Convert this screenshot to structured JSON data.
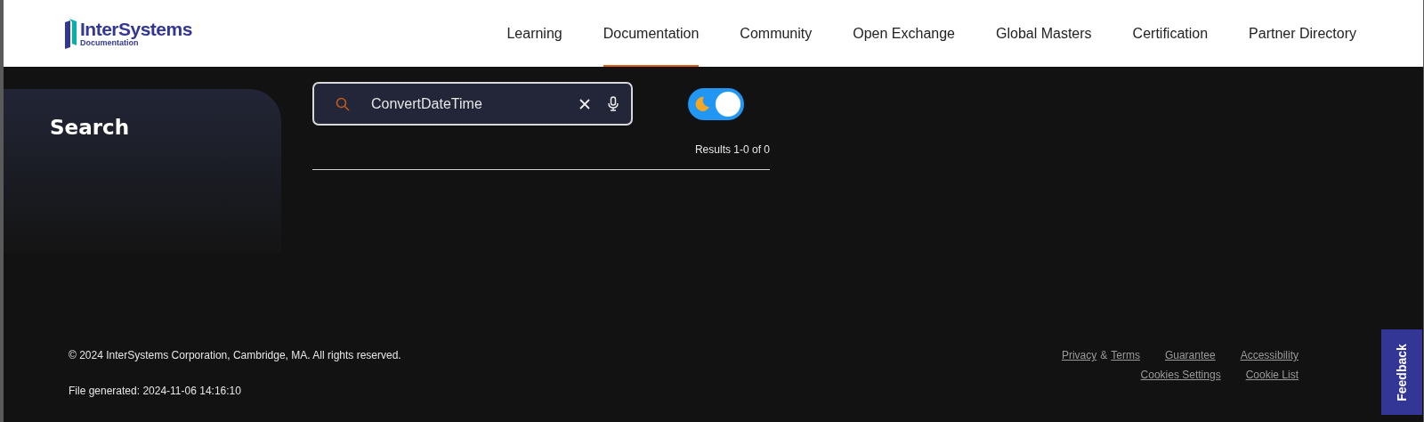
{
  "header": {
    "logo": {
      "name": "InterSystems",
      "subtitle": "Documentation"
    },
    "nav": [
      {
        "label": "Learning",
        "selected": false
      },
      {
        "label": "Documentation",
        "selected": true
      },
      {
        "label": "Community",
        "selected": false
      },
      {
        "label": "Open Exchange",
        "selected": false
      },
      {
        "label": "Global Masters",
        "selected": false
      },
      {
        "label": "Certification",
        "selected": false
      },
      {
        "label": "Partner Directory",
        "selected": false
      }
    ]
  },
  "sidebar": {
    "title": "Search"
  },
  "search": {
    "value": "ConvertDateTime"
  },
  "dark_mode_toggle": {
    "on": true
  },
  "results": "Results 1-0 of 0",
  "footer": {
    "copyright": "© 2024 InterSystems Corporation, Cambridge, MA. All rights reserved.",
    "generated": "File generated: 2024-11-06 14:16:10",
    "link_rows": [
      [
        {
          "kind": "link",
          "label": "Privacy"
        },
        {
          "kind": "text",
          "label": "&"
        },
        {
          "kind": "link",
          "label": "Terms"
        },
        {
          "kind": "gap"
        },
        {
          "kind": "link",
          "label": "Guarantee"
        },
        {
          "kind": "gap"
        },
        {
          "kind": "link",
          "label": "Accessibility"
        }
      ],
      [
        {
          "kind": "link",
          "label": "Cookies Settings"
        },
        {
          "kind": "gap"
        },
        {
          "kind": "link",
          "label": "Cookie List"
        }
      ]
    ]
  },
  "feedback": "Feedback"
}
